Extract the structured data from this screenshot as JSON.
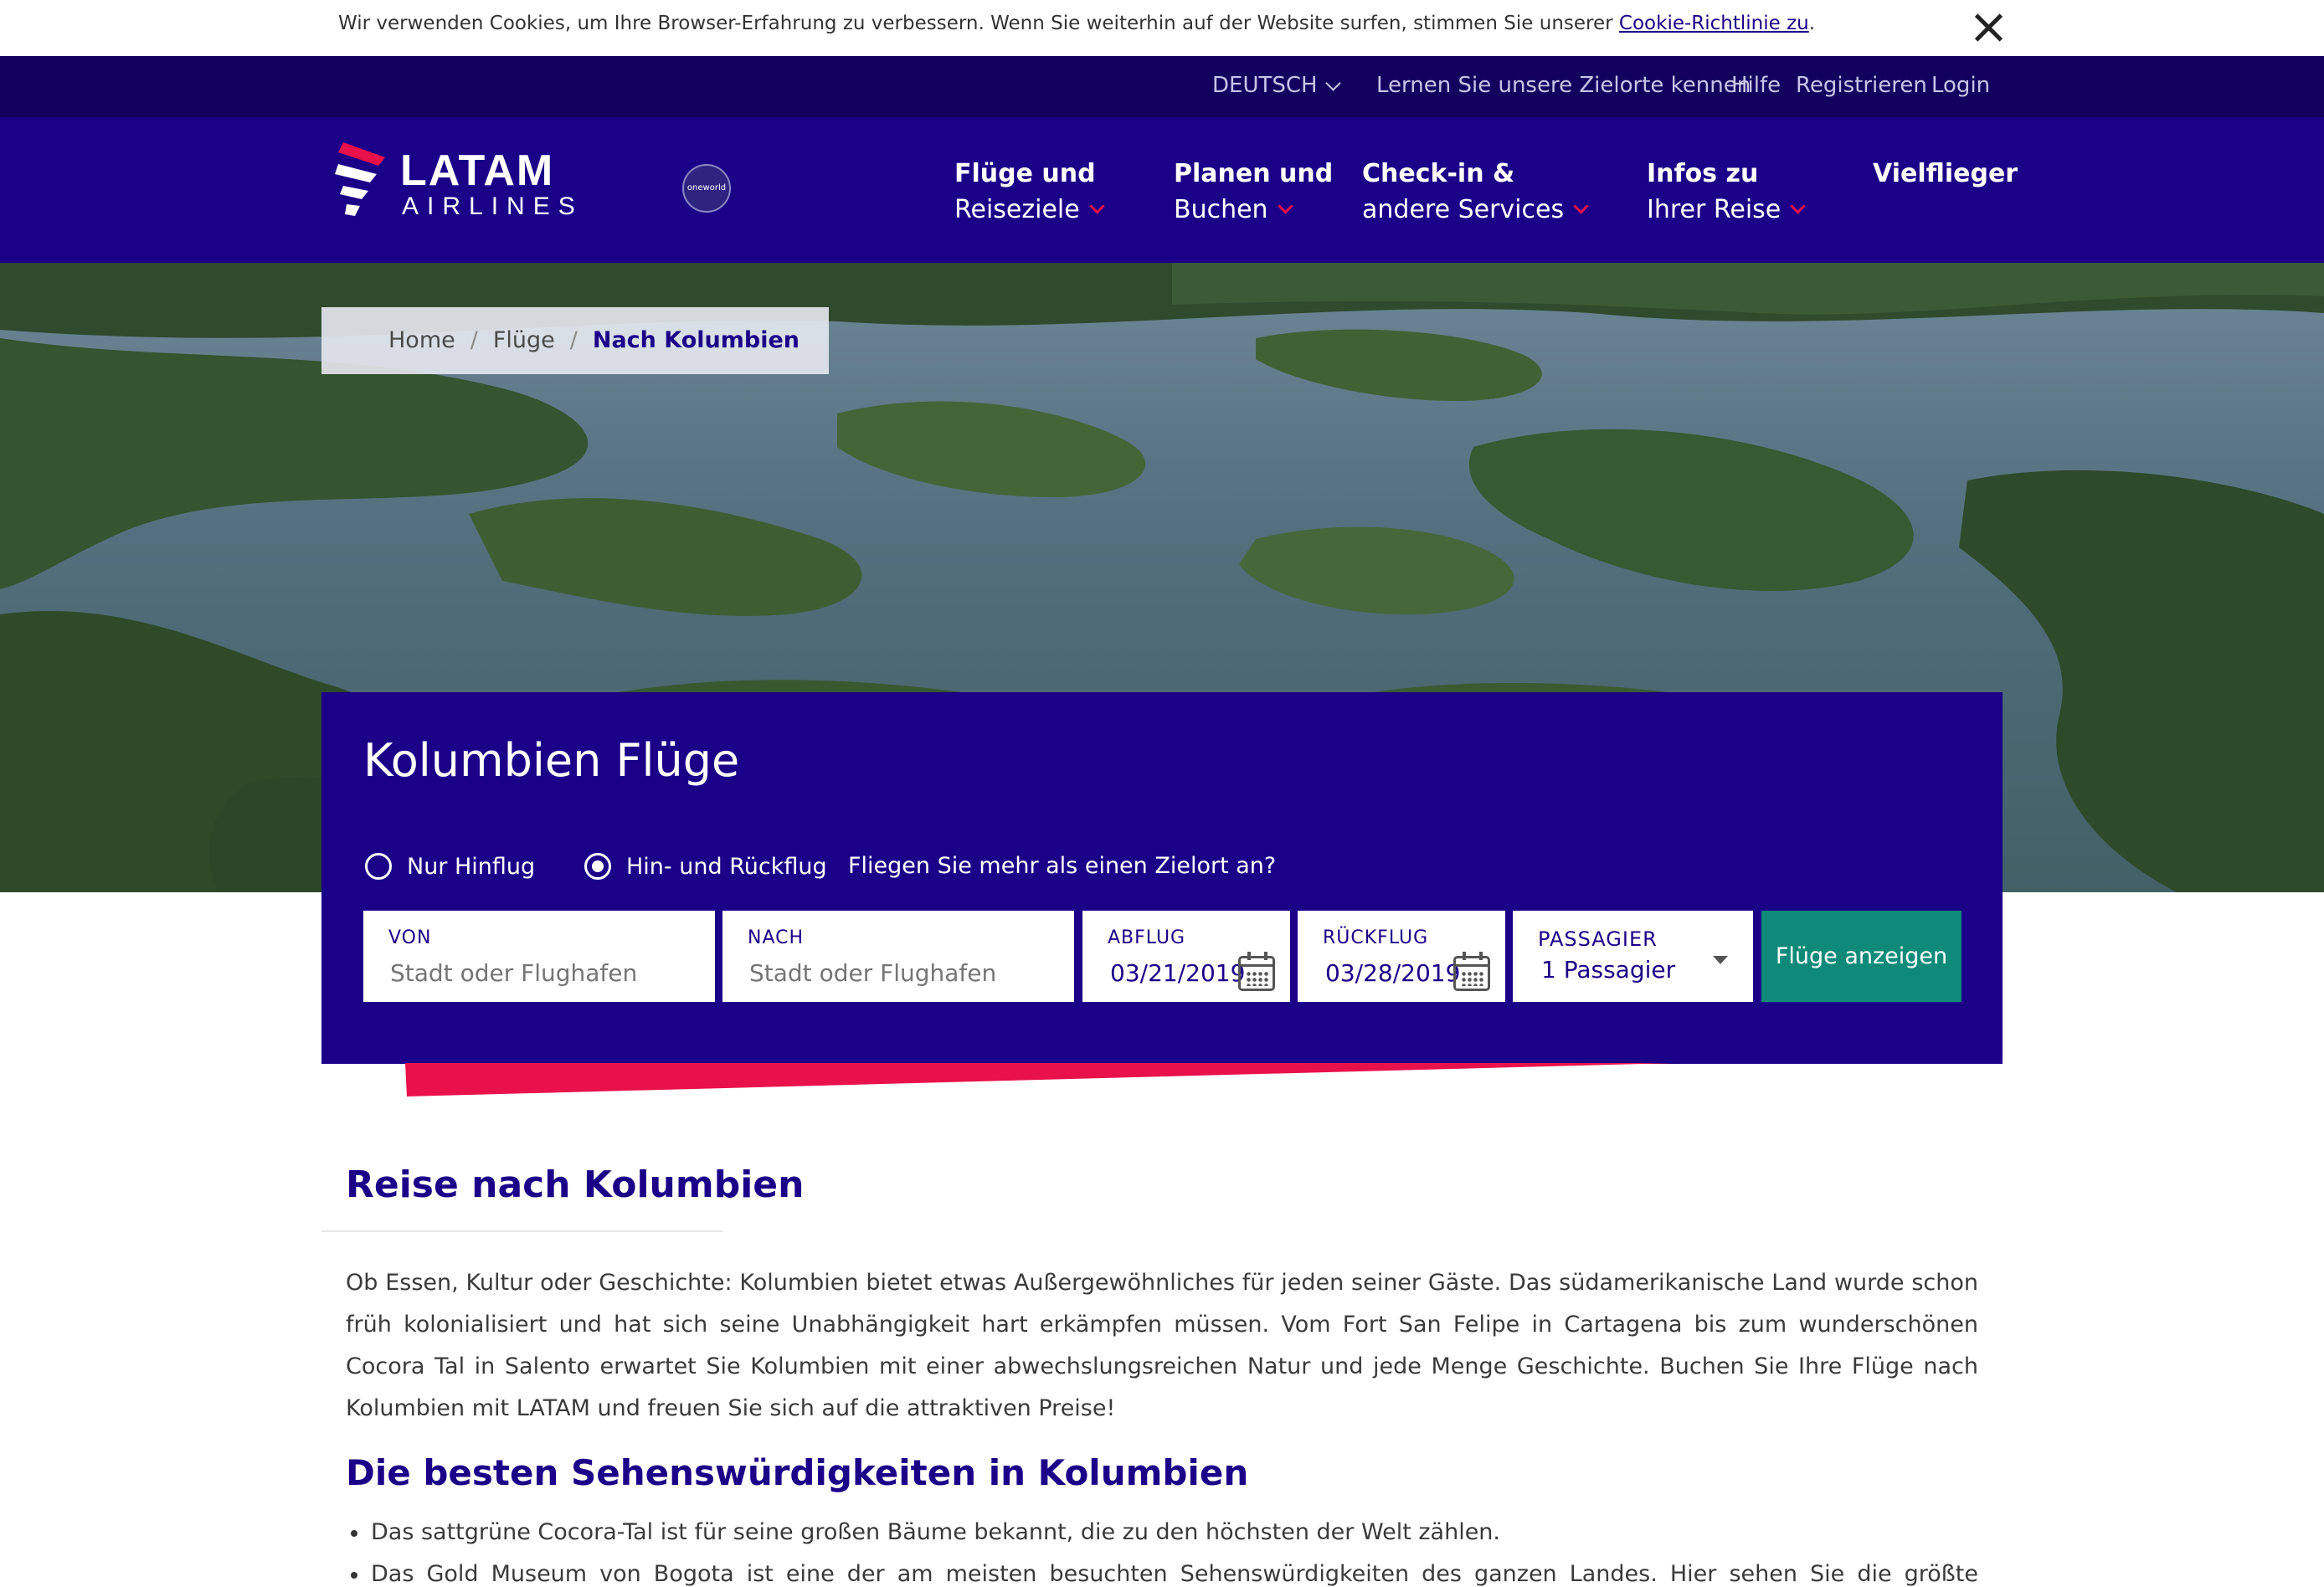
{
  "cookie_bar": {
    "text": "Wir verwenden Cookies, um Ihre Browser-Erfahrung zu verbessern. Wenn Sie weiterhin auf der Website surfen, stimmen Sie unserer ",
    "link": "Cookie-Richtlinie zu",
    "suffix": "."
  },
  "utility_nav": {
    "language": "DEUTSCH",
    "items": [
      "Lernen Sie unsere Zielorte kennen",
      "Hilfe",
      "Registrieren",
      "Login"
    ]
  },
  "logo": {
    "word": "LATAM",
    "sub": "AIRLINES",
    "alliance": "oneworld"
  },
  "main_nav": [
    {
      "line1": "Flüge und",
      "line2": "Reiseziele"
    },
    {
      "line1": "Planen und",
      "line2": "Buchen"
    },
    {
      "line1": "Check-in &",
      "line2": "andere Services"
    },
    {
      "line1": "Infos zu",
      "line2": "Ihrer Reise"
    },
    {
      "line1": "Vielflieger",
      "line2": ""
    }
  ],
  "breadcrumb": {
    "home": "Home",
    "flights": "Flüge",
    "current": "Nach Kolumbien"
  },
  "search": {
    "title": "Kolumbien Flüge",
    "trip_types": [
      {
        "label": "Nur Hinflug",
        "checked": false
      },
      {
        "label": "Hin- und Rückflug",
        "checked": true
      }
    ],
    "multi_city": "Fliegen Sie mehr als einen Zielort an?",
    "from": {
      "label": "VON",
      "placeholder": "Stadt oder Flughafen"
    },
    "to": {
      "label": "NACH",
      "placeholder": "Stadt oder Flughafen"
    },
    "depart": {
      "label": "ABFLUG",
      "value": "03/21/2019"
    },
    "return": {
      "label": "RÜCKFLUG",
      "value": "03/28/2019"
    },
    "passengers": {
      "label": "PASSAGIER",
      "value": "1 Passagier"
    },
    "submit": "Flüge anzeigen"
  },
  "content": {
    "title": "Reise nach Kolumbien",
    "intro": "Ob Essen, Kultur oder Geschichte: Kolumbien bietet etwas Außergewöhnliches für jeden seiner Gäste. Das südamerikanische Land wurde schon früh kolonialisiert und hat sich seine Unabhängigkeit hart erkämpfen müssen. Vom Fort San Felipe in Cartagena bis zum wunderschönen Cocora Tal in Salento erwartet Sie Kolumbien mit einer abwechslungsreichen Natur und jede Menge Geschichte. Buchen Sie Ihre Flüge nach Kolumbien mit LATAM und freuen Sie sich auf die attraktiven Preise!",
    "subheading": "Die besten Sehenswürdigkeiten in Kolumbien",
    "sights": [
      "Das sattgrüne Cocora-Tal ist für seine großen Bäume bekannt, die zu den höchsten der Welt zählen.",
      "Das Gold Museum von Bogota ist eine der am meisten besuchten Sehenswürdigkeiten des ganzen Landes. Hier sehen Sie die größte Sammlung"
    ]
  },
  "colors": {
    "brand_indigo": "#1b0088",
    "util_bar": "#13005e",
    "accent_red": "#e8114b",
    "cta_teal": "#0f8a79"
  }
}
